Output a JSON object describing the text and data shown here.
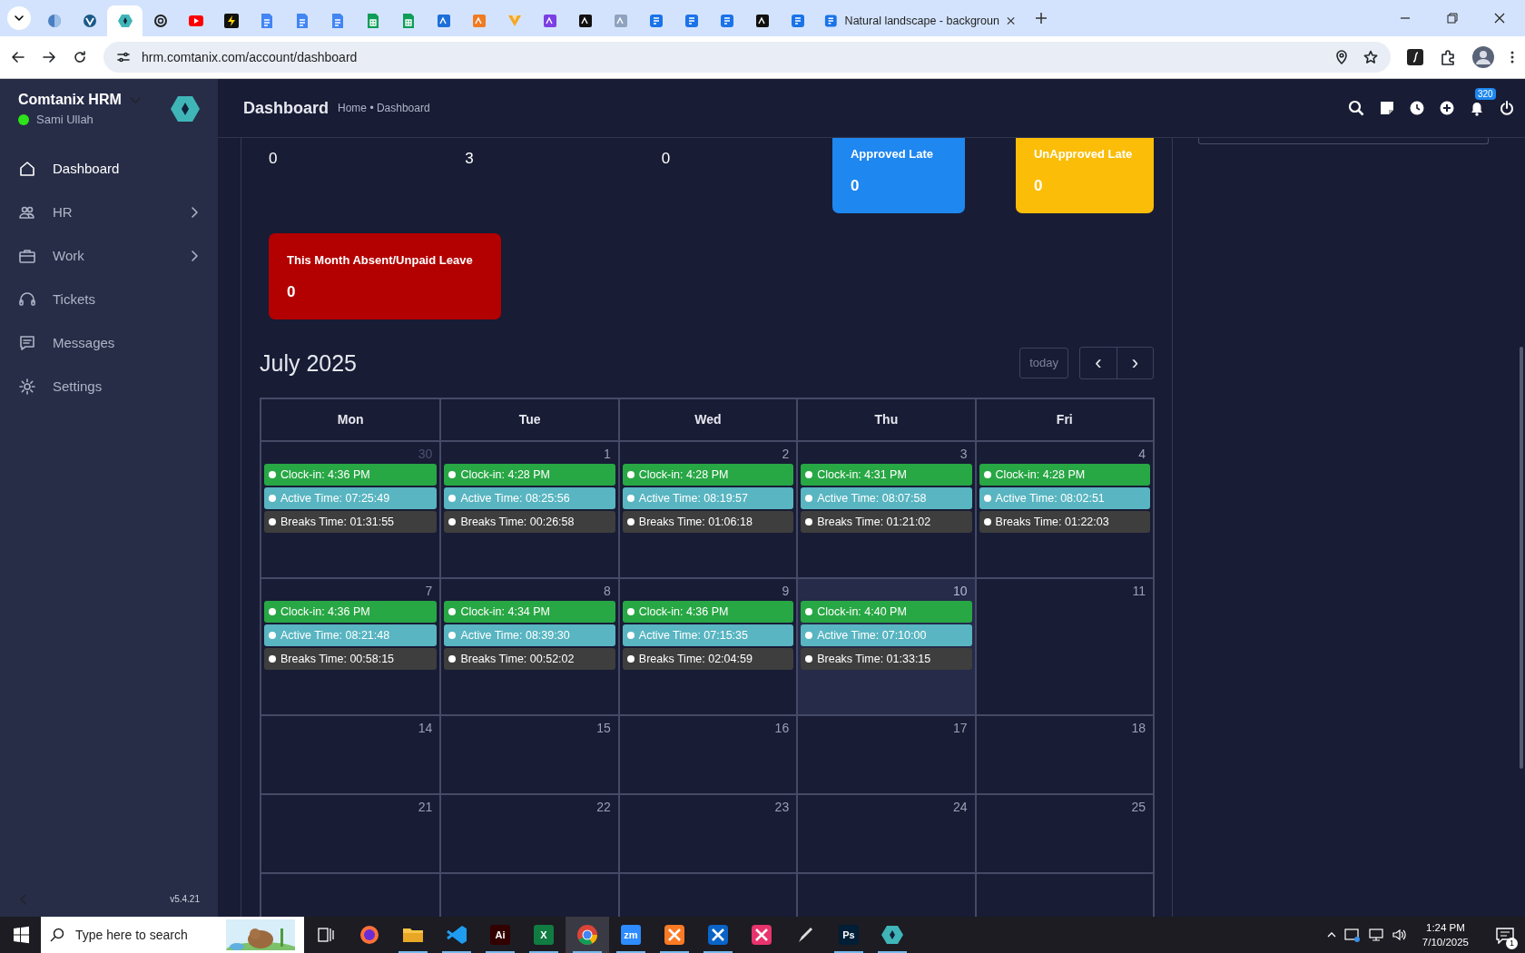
{
  "browser": {
    "tabs": [
      {
        "kind": "circle",
        "color": "#4a7fc1",
        "selected": false
      },
      {
        "kind": "shield",
        "color": "#1a5a8a",
        "selected": false
      },
      {
        "kind": "diamond",
        "color": "#3fb5b8",
        "selected": true
      },
      {
        "kind": "ring",
        "color": "#222222",
        "selected": false
      },
      {
        "kind": "play",
        "color": "#ff0000",
        "selected": false
      },
      {
        "kind": "bolt",
        "color": "#111111",
        "selected": false
      },
      {
        "kind": "doc",
        "color": "#4285f4",
        "selected": false
      },
      {
        "kind": "doc",
        "color": "#4285f4",
        "selected": false
      },
      {
        "kind": "doc",
        "color": "#4285f4",
        "selected": false
      },
      {
        "kind": "sheet",
        "color": "#0f9d58",
        "selected": false
      },
      {
        "kind": "sheet",
        "color": "#0f9d58",
        "selected": false
      },
      {
        "kind": "square",
        "color": "#1e6fd9",
        "selected": false
      },
      {
        "kind": "square",
        "color": "#f07b22",
        "selected": false
      },
      {
        "kind": "triangle",
        "color": "#f5a623",
        "selected": false
      },
      {
        "kind": "square",
        "color": "#7b3fe4",
        "selected": false
      },
      {
        "kind": "square",
        "color": "#111111",
        "selected": false
      },
      {
        "kind": "square",
        "color": "#8fa3c0",
        "selected": false
      },
      {
        "kind": "form",
        "color": "#1a73e8",
        "selected": false
      },
      {
        "kind": "form",
        "color": "#1a73e8",
        "selected": false
      },
      {
        "kind": "form",
        "color": "#1a73e8",
        "selected": false
      },
      {
        "kind": "square",
        "color": "#111111",
        "selected": false
      },
      {
        "kind": "form",
        "color": "#1a73e8",
        "selected": false
      },
      {
        "kind": "form",
        "color": "#1a73e8",
        "selected": false,
        "title": "Natural landscape - backgroun"
      }
    ],
    "url": "hrm.comtanix.com/account/dashboard"
  },
  "sidebar": {
    "app_name": "Comtanix HRM",
    "user": "Sami Ullah",
    "online": true,
    "items": [
      {
        "label": "Dashboard",
        "expandable": false,
        "selected": true
      },
      {
        "label": "HR",
        "expandable": true,
        "selected": false
      },
      {
        "label": "Work",
        "expandable": true,
        "selected": false
      },
      {
        "label": "Tickets",
        "expandable": false,
        "selected": false
      },
      {
        "label": "Messages",
        "expandable": false,
        "selected": false
      },
      {
        "label": "Settings",
        "expandable": false,
        "selected": false
      }
    ],
    "version": "v5.4.21"
  },
  "header": {
    "title": "Dashboard",
    "breadcrumb": "Home • Dashboard",
    "notification_count": "320"
  },
  "stats": [
    {
      "value": "0"
    },
    {
      "value": "3"
    },
    {
      "value": "0"
    }
  ],
  "stat_cards": [
    {
      "label": "Approved Late",
      "value": "0",
      "color": "#1e87f0"
    },
    {
      "label": "UnApproved Late",
      "value": "0",
      "color": "#fbbd08"
    },
    {
      "label": "This Month Absent/Unpaid Leave",
      "value": "0",
      "color": "#b30000"
    }
  ],
  "calendar": {
    "title": "July 2025",
    "today_button": "today",
    "prev": "‹",
    "next": "›",
    "columns": [
      "Mon",
      "Tue",
      "Wed",
      "Thu",
      "Fri"
    ],
    "weeks": [
      {
        "days": [
          {
            "number": "30",
            "other_month": true,
            "today": false,
            "events": [
              {
                "kind": "clockin",
                "text": "Clock-in: 4:36 PM"
              },
              {
                "kind": "active",
                "text": "Active Time: 07:25:49"
              },
              {
                "kind": "breaks",
                "text": "Breaks Time: 01:31:55"
              }
            ]
          },
          {
            "number": "1",
            "other_month": false,
            "today": false,
            "events": [
              {
                "kind": "clockin",
                "text": "Clock-in: 4:28 PM"
              },
              {
                "kind": "active",
                "text": "Active Time: 08:25:56"
              },
              {
                "kind": "breaks",
                "text": "Breaks Time: 00:26:58"
              }
            ]
          },
          {
            "number": "2",
            "other_month": false,
            "today": false,
            "events": [
              {
                "kind": "clockin",
                "text": "Clock-in: 4:28 PM"
              },
              {
                "kind": "active",
                "text": "Active Time: 08:19:57"
              },
              {
                "kind": "breaks",
                "text": "Breaks Time: 01:06:18"
              }
            ]
          },
          {
            "number": "3",
            "other_month": false,
            "today": false,
            "events": [
              {
                "kind": "clockin",
                "text": "Clock-in: 4:31 PM"
              },
              {
                "kind": "active",
                "text": "Active Time: 08:07:58"
              },
              {
                "kind": "breaks",
                "text": "Breaks Time: 01:21:02"
              }
            ]
          },
          {
            "number": "4",
            "other_month": false,
            "today": false,
            "events": [
              {
                "kind": "clockin",
                "text": "Clock-in: 4:28 PM"
              },
              {
                "kind": "active",
                "text": "Active Time: 08:02:51"
              },
              {
                "kind": "breaks",
                "text": "Breaks Time: 01:22:03"
              }
            ]
          }
        ]
      },
      {
        "days": [
          {
            "number": "7",
            "other_month": false,
            "today": false,
            "events": [
              {
                "kind": "clockin",
                "text": "Clock-in: 4:36 PM"
              },
              {
                "kind": "active",
                "text": "Active Time: 08:21:48"
              },
              {
                "kind": "breaks",
                "text": "Breaks Time: 00:58:15"
              }
            ]
          },
          {
            "number": "8",
            "other_month": false,
            "today": false,
            "events": [
              {
                "kind": "clockin",
                "text": "Clock-in: 4:34 PM"
              },
              {
                "kind": "active",
                "text": "Active Time: 08:39:30"
              },
              {
                "kind": "breaks",
                "text": "Breaks Time: 00:52:02"
              }
            ]
          },
          {
            "number": "9",
            "other_month": false,
            "today": false,
            "events": [
              {
                "kind": "clockin",
                "text": "Clock-in: 4:36 PM"
              },
              {
                "kind": "active",
                "text": "Active Time: 07:15:35"
              },
              {
                "kind": "breaks",
                "text": "Breaks Time: 02:04:59"
              }
            ]
          },
          {
            "number": "10",
            "other_month": false,
            "today": true,
            "events": [
              {
                "kind": "clockin",
                "text": "Clock-in: 4:40 PM"
              },
              {
                "kind": "active",
                "text": "Active Time: 07:10:00"
              },
              {
                "kind": "breaks",
                "text": "Breaks Time: 01:33:15"
              }
            ]
          },
          {
            "number": "11",
            "other_month": false,
            "today": false
          }
        ]
      },
      {
        "days": [
          {
            "number": "14",
            "other_month": false,
            "today": false
          },
          {
            "number": "15",
            "other_month": false,
            "today": false
          },
          {
            "number": "16",
            "other_month": false,
            "today": false
          },
          {
            "number": "17",
            "other_month": false,
            "today": false
          },
          {
            "number": "18",
            "other_month": false,
            "today": false
          }
        ]
      },
      {
        "days": [
          {
            "number": "21",
            "other_month": false,
            "today": false
          },
          {
            "number": "22",
            "other_month": false,
            "today": false
          },
          {
            "number": "23",
            "other_month": false,
            "today": false
          },
          {
            "number": "24",
            "other_month": false,
            "today": false
          },
          {
            "number": "25",
            "other_month": false,
            "today": false
          }
        ]
      }
    ]
  },
  "taskbar": {
    "search_placeholder": "Type here to search",
    "apps": [
      {
        "kind": "firefox",
        "color": "#ff7139",
        "running": false,
        "selected": false
      },
      {
        "kind": "folder",
        "color": "#f8c648",
        "running": true,
        "selected": false
      },
      {
        "kind": "code",
        "color": "#1f9cf0",
        "running": true,
        "selected": false
      },
      {
        "kind": "letters",
        "label": "Ai",
        "color": "#330000",
        "running": true,
        "selected": false
      },
      {
        "kind": "letters",
        "label": "X",
        "color": "#107c41",
        "running": true,
        "selected": false
      },
      {
        "kind": "chrome",
        "color": "#db4437",
        "running": true,
        "selected": true
      },
      {
        "kind": "letters",
        "label": "zm",
        "color": "#2d8cff",
        "running": true,
        "selected": false
      },
      {
        "kind": "square",
        "color": "#fb7a24",
        "running": true,
        "selected": false
      },
      {
        "kind": "square",
        "color": "#0a64c8",
        "running": true,
        "selected": false
      },
      {
        "kind": "square",
        "color": "#e8336d",
        "running": false,
        "selected": false
      },
      {
        "kind": "pen",
        "color": "#dddddd",
        "running": false,
        "selected": false
      },
      {
        "kind": "letters",
        "label": "Ps",
        "color": "#001e36",
        "running": true,
        "selected": false
      },
      {
        "kind": "diamond",
        "color": "#3fb5b8",
        "running": true,
        "selected": false
      }
    ],
    "time": "1:24 PM",
    "date": "7/10/2025",
    "notifications": "1"
  }
}
